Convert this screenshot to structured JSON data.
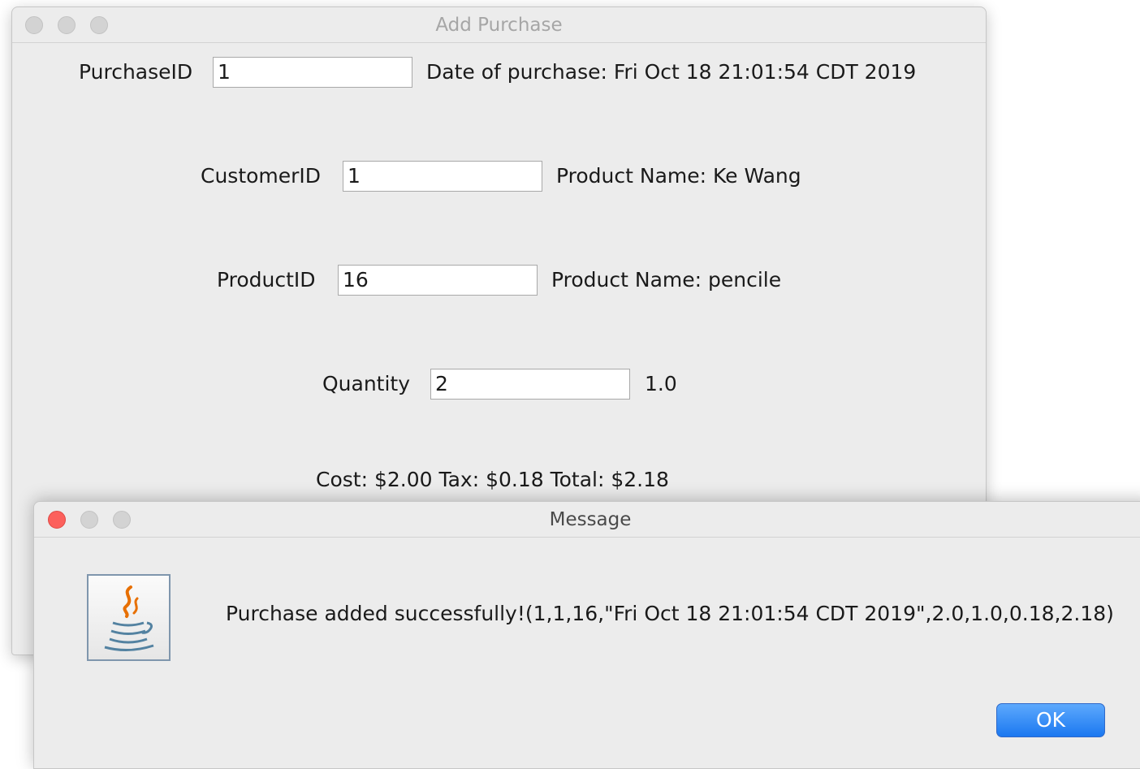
{
  "main_window": {
    "title": "Add Purchase",
    "purchase_id": {
      "label": "PurchaseID",
      "value": "1",
      "info": "Date of purchase: Fri Oct 18 21:01:54 CDT 2019"
    },
    "customer_id": {
      "label": "CustomerID",
      "value": "1",
      "info": "Product Name: Ke Wang"
    },
    "product_id": {
      "label": "ProductID",
      "value": "16",
      "info": "Product Name: pencile"
    },
    "quantity": {
      "label": "Quantity",
      "value": "2",
      "info": "1.0"
    },
    "summary": "Cost: $2.00 Tax: $0.18 Total: $2.18"
  },
  "dialog": {
    "title": "Message",
    "icon": "java-coffee-cup-icon",
    "message": "Purchase added successfully!(1,1,16,\"Fri Oct 18 21:01:54 CDT 2019\",2.0,1.0,0.18,2.18)",
    "ok_label": "OK"
  },
  "colors": {
    "window_bg": "#ececec",
    "close_red": "#fc605c",
    "ok_blue": "#1b78f0",
    "java_orange": "#e76f00",
    "java_blue": "#5382a1"
  }
}
